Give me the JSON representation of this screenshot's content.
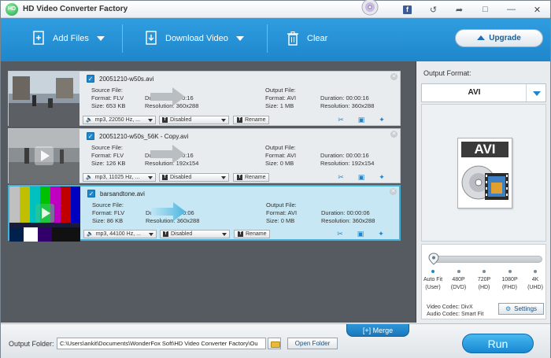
{
  "window": {
    "title": "HD Video Converter Factory"
  },
  "toolbar": {
    "add_files": "Add Files",
    "download_video": "Download Video",
    "clear": "Clear",
    "upgrade": "Upgrade"
  },
  "files": [
    {
      "name": "20051210-w50s.avi",
      "source_label": "Source File:",
      "source_format": "Format: FLV",
      "source_duration": "Duration: 00:00:16",
      "source_size": "Size: 653 KB",
      "source_resolution": "Resolution: 360x288",
      "output_label": "Output File:",
      "output_format": "Format: AVI",
      "output_duration": "Duration: 00:00:16",
      "output_size": "Size: 1 MB",
      "output_resolution": "Resolution: 360x288",
      "audio": "mp3, 22050 Hz, ...",
      "subtitle": "Disabled",
      "rename": "Rename",
      "selected": false
    },
    {
      "name": "20051210-w50s_56K - Copy.avi",
      "source_label": "Source File:",
      "source_format": "Format: FLV",
      "source_duration": "Duration: 00:00:16",
      "source_size": "Size: 126 KB",
      "source_resolution": "Resolution: 192x154",
      "output_label": "Output File:",
      "output_format": "Format: AVI",
      "output_duration": "Duration: 00:00:16",
      "output_size": "Size: 0 MB",
      "output_resolution": "Resolution: 192x154",
      "audio": "mp3, 11025 Hz, ...",
      "subtitle": "Disabled",
      "rename": "Rename",
      "selected": false
    },
    {
      "name": "barsandtone.avi",
      "source_label": "Source File:",
      "source_format": "Format: FLV",
      "source_duration": "Duration: 00:00:06",
      "source_size": "Size: 86 KB",
      "source_resolution": "Resolution: 360x288",
      "output_label": "Output File:",
      "output_format": "Format: AVI",
      "output_duration": "Duration: 00:00:06",
      "output_size": "Size: 0 MB",
      "output_resolution": "Resolution: 360x288",
      "audio": "mp3, 44100 Hz, ...",
      "subtitle": "Disabled",
      "rename": "Rename",
      "selected": true
    }
  ],
  "output_format": {
    "label": "Output Format:",
    "value": "AVI",
    "badge": "AVI"
  },
  "quality": {
    "level": 0,
    "presets": [
      {
        "line1": "Auto Fit",
        "line2": "(User)"
      },
      {
        "line1": "480P",
        "line2": "(DVD)"
      },
      {
        "line1": "720P",
        "line2": "(HD)"
      },
      {
        "line1": "1080P",
        "line2": "(FHD)"
      },
      {
        "line1": "4K",
        "line2": "(UHD)"
      }
    ],
    "video_codec": "Video Codec: DivX",
    "audio_codec": "Audio Codec: Smart Fit",
    "settings": "Settings"
  },
  "bottom": {
    "merge": "[+] Merge",
    "output_folder_label": "Output Folder:",
    "output_folder_path": "C:\\Users\\ankit\\Documents\\WonderFox Soft\\HD Video Converter Factory\\Ou",
    "open_folder": "Open Folder",
    "run": "Run"
  },
  "colors": {
    "accent": "#1f86cb",
    "selected_row": "#c6e7f3",
    "selected_border": "#43b2d9"
  }
}
